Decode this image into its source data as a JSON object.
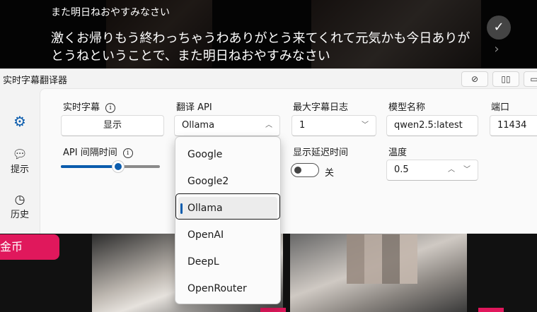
{
  "subtitles": {
    "previous": "また明日ねおやすみなさい",
    "current": "激くお帰りもう終わっちゃうわありがとう来てくれて元気かも今日ありがとうねということで、また明日ねおやすみなさい",
    "confirm_icon": "checkmark-icon",
    "next_icon": "chevron-right-icon"
  },
  "background": {
    "coin_button": "金币"
  },
  "window": {
    "title": "实时字幕翻译器",
    "titlebar_buttons": [
      "pin-icon",
      "split-view-icon",
      "window-icon"
    ]
  },
  "sidebar": {
    "items": [
      {
        "label": "",
        "icon": "gear-icon"
      },
      {
        "label": "提示",
        "icon": "chat-bubble-icon"
      },
      {
        "label": "历史",
        "icon": "history-clock-icon"
      }
    ]
  },
  "settings": {
    "live_subtitle": {
      "label": "实时字幕",
      "button": "显示"
    },
    "translate_api": {
      "label": "翻译 API",
      "value": "Ollama"
    },
    "max_log": {
      "label": "最大字幕日志",
      "value": "1"
    },
    "model_name": {
      "label": "模型名称",
      "value": "qwen2.5:latest"
    },
    "port": {
      "label": "端口",
      "value": "11434"
    },
    "api_interval": {
      "label": "API 间隔时间",
      "slider_fraction": 0.58
    },
    "show_delay": {
      "label": "显示延迟时间",
      "state_label": "关",
      "on": false
    },
    "temperature": {
      "label": "温度",
      "value": "0.5"
    }
  },
  "dropdown": {
    "options": [
      "Google",
      "Google2",
      "Ollama",
      "OpenAI",
      "DeepL",
      "OpenRouter"
    ],
    "selected": "Ollama"
  },
  "colors": {
    "accent": "#0b5cad",
    "pink": "#e0185c"
  }
}
